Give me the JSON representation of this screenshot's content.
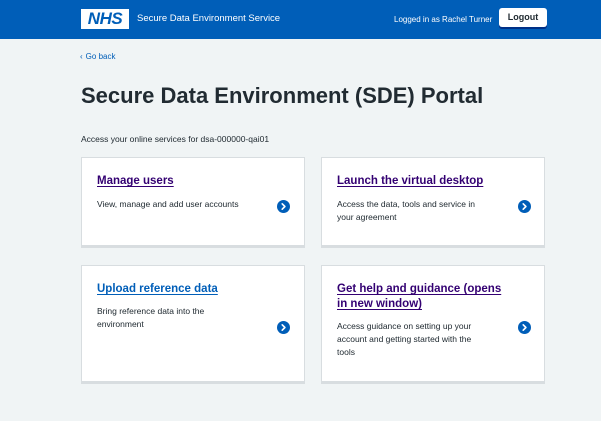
{
  "header": {
    "logo_text": "NHS",
    "service_name": "Secure Data Environment Service",
    "logged_in": "Logged in as Rachel Turner",
    "logout_label": "Logout"
  },
  "nav": {
    "back_label": "Go back",
    "back_icon": "chevron-left-icon"
  },
  "main": {
    "title": "Secure Data Environment (SDE) Portal",
    "intro": "Access your online services for dsa-000000-qai01"
  },
  "cards": [
    {
      "title": "Manage users",
      "description_lines": [
        "View, manage and add user accounts"
      ],
      "icon": "arrow-right-circle-icon"
    },
    {
      "title": "Launch the virtual desktop",
      "description_lines": [
        "Access the data, tools and service in",
        "your agreement"
      ],
      "icon": "arrow-right-circle-icon"
    },
    {
      "title": "Upload reference data",
      "description_lines": [
        "Bring reference data into the",
        "environment"
      ],
      "icon": "arrow-right-circle-icon"
    },
    {
      "title_lines": [
        "Get help and guidance (opens",
        "in new window)"
      ],
      "description_lines": [
        "Access guidance on setting up your",
        "account and getting started with the",
        "tools"
      ],
      "icon": "arrow-right-circle-icon"
    }
  ],
  "colors": {
    "header_blue": "#005eb8",
    "page_bg": "#f0f4f5",
    "visited_link": "#330072",
    "text": "#212b32"
  }
}
